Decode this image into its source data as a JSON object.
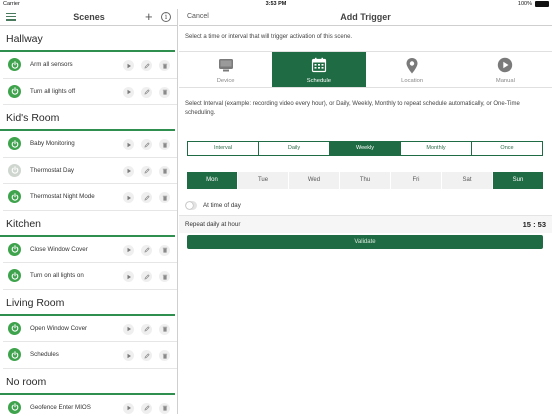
{
  "status": {
    "carrier": "Carrier",
    "time": "3:53 PM",
    "battery": "100%"
  },
  "scenes": {
    "title": "Scenes",
    "plus_label": "+",
    "info_label": "i",
    "sections": [
      {
        "name": "Hallway",
        "items": [
          {
            "label": "Arm all sensors",
            "on": true
          },
          {
            "label": "Turn all lights off",
            "on": true
          }
        ]
      },
      {
        "name": "Kid's Room",
        "items": [
          {
            "label": "Baby Monitoring",
            "on": true
          },
          {
            "label": "Thermostat Day",
            "on": false
          },
          {
            "label": "Thermostat Night Mode",
            "on": true
          }
        ]
      },
      {
        "name": "Kitchen",
        "items": [
          {
            "label": "Close Window Cover",
            "on": true
          },
          {
            "label": "Turn on all lights on",
            "on": true
          }
        ]
      },
      {
        "name": "Living Room",
        "items": [
          {
            "label": "Open Window Cover",
            "on": true
          },
          {
            "label": "Schedules",
            "on": true
          }
        ]
      },
      {
        "name": "No room",
        "items": [
          {
            "label": "Geofence Enter MIOS",
            "on": true
          }
        ]
      }
    ]
  },
  "trigger": {
    "cancel_label": "Cancel",
    "title": "Add Trigger",
    "instruction": "Select a time or interval that will trigger activation of this scene.",
    "tabs": [
      {
        "label": "Device",
        "icon": "device-icon",
        "active": false
      },
      {
        "label": "Schedule",
        "icon": "calendar-icon",
        "active": true
      },
      {
        "label": "Location",
        "icon": "location-pin-icon",
        "active": false
      },
      {
        "label": "Manual",
        "icon": "play-icon",
        "active": false
      }
    ],
    "interval_description": "Select Interval (example: recording video every hour), or Daily, Weekly, Monthly to repeat schedule automatically, or One-Time scheduling.",
    "intervals": [
      {
        "label": "Interval",
        "active": false
      },
      {
        "label": "Daily",
        "active": false
      },
      {
        "label": "Weekly",
        "active": true
      },
      {
        "label": "Monthly",
        "active": false
      },
      {
        "label": "Once",
        "active": false
      }
    ],
    "days": [
      {
        "label": "Mon",
        "active": true
      },
      {
        "label": "Tue",
        "active": false
      },
      {
        "label": "Wed",
        "active": false
      },
      {
        "label": "Thu",
        "active": false
      },
      {
        "label": "Fri",
        "active": false
      },
      {
        "label": "Sat",
        "active": false
      },
      {
        "label": "Sun",
        "active": true
      }
    ],
    "at_time_label": "At time of day",
    "repeat_label": "Repeat daily at hour",
    "repeat_time": "15 : 53",
    "validate_label": "Validate"
  },
  "colors": {
    "accent": "#1f6b43",
    "power_on": "#3ea34c",
    "section_rule": "#2f8f4e"
  }
}
